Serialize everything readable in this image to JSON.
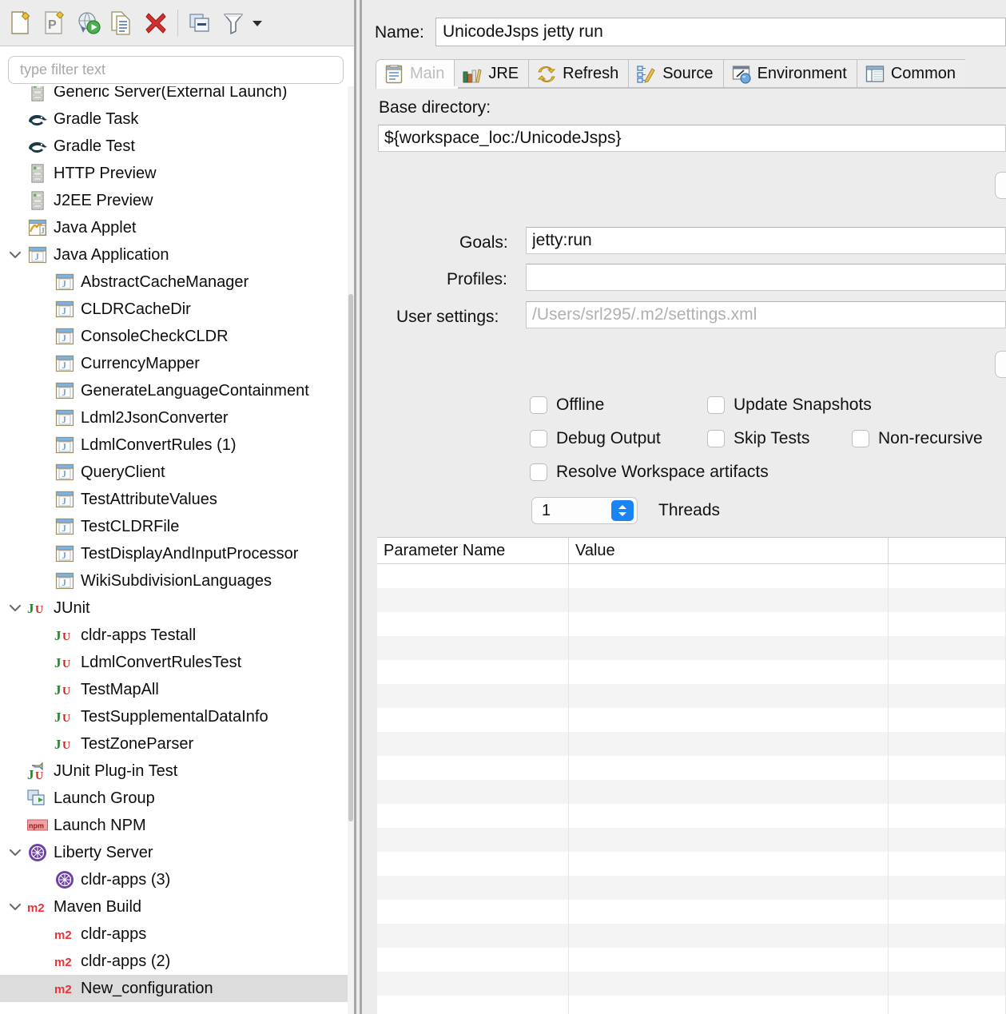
{
  "toolbar": {
    "buttons": [
      {
        "name": "new-launch-configuration-button",
        "icon": "new-config-icon",
        "tooltip": "New launch configuration"
      },
      {
        "name": "new-prototype-button",
        "icon": "new-prototype-icon",
        "tooltip": "New prototype"
      },
      {
        "name": "export-launch-configuration-button",
        "icon": "export-run-icon",
        "tooltip": "Export"
      },
      {
        "name": "duplicate-button",
        "icon": "duplicate-icon",
        "tooltip": "Duplicate"
      },
      {
        "name": "delete-button",
        "icon": "delete-x-icon",
        "tooltip": "Delete"
      },
      {
        "name": "collapse-all-button",
        "icon": "collapse-all-icon",
        "tooltip": "Collapse All"
      },
      {
        "name": "filter-button",
        "icon": "filter-funnel-icon",
        "tooltip": "Filter"
      }
    ],
    "filter_menu_caret": "chevron-down-icon"
  },
  "filter": {
    "placeholder": "type filter text",
    "value": ""
  },
  "tree": {
    "items": [
      {
        "label": "Generic Server(External Launch)",
        "icon": "server-icon",
        "depth": 0,
        "twist": "none",
        "selected": false
      },
      {
        "label": "Gradle Task",
        "icon": "gradle-icon",
        "depth": 0,
        "twist": "none",
        "selected": false
      },
      {
        "label": "Gradle Test",
        "icon": "gradle-icon",
        "depth": 0,
        "twist": "none",
        "selected": false
      },
      {
        "label": "HTTP Preview",
        "icon": "server-icon",
        "depth": 0,
        "twist": "none",
        "selected": false
      },
      {
        "label": "J2EE Preview",
        "icon": "server-icon",
        "depth": 0,
        "twist": "none",
        "selected": false
      },
      {
        "label": "Java Applet",
        "icon": "java-applet-icon",
        "depth": 0,
        "twist": "none",
        "selected": false
      },
      {
        "label": "Java Application",
        "icon": "java-app-icon",
        "depth": 0,
        "twist": "expanded",
        "selected": false
      },
      {
        "label": "AbstractCacheManager",
        "icon": "java-app-icon",
        "depth": 1,
        "twist": "none",
        "selected": false
      },
      {
        "label": "CLDRCacheDir",
        "icon": "java-app-icon",
        "depth": 1,
        "twist": "none",
        "selected": false
      },
      {
        "label": "ConsoleCheckCLDR",
        "icon": "java-app-icon",
        "depth": 1,
        "twist": "none",
        "selected": false
      },
      {
        "label": "CurrencyMapper",
        "icon": "java-app-icon",
        "depth": 1,
        "twist": "none",
        "selected": false
      },
      {
        "label": "GenerateLanguageContainment",
        "icon": "java-app-icon",
        "depth": 1,
        "twist": "none",
        "selected": false
      },
      {
        "label": "Ldml2JsonConverter",
        "icon": "java-app-icon",
        "depth": 1,
        "twist": "none",
        "selected": false
      },
      {
        "label": "LdmlConvertRules (1)",
        "icon": "java-app-icon",
        "depth": 1,
        "twist": "none",
        "selected": false
      },
      {
        "label": "QueryClient",
        "icon": "java-app-icon",
        "depth": 1,
        "twist": "none",
        "selected": false
      },
      {
        "label": "TestAttributeValues",
        "icon": "java-app-icon",
        "depth": 1,
        "twist": "none",
        "selected": false
      },
      {
        "label": "TestCLDRFile",
        "icon": "java-app-icon",
        "depth": 1,
        "twist": "none",
        "selected": false
      },
      {
        "label": "TestDisplayAndInputProcessor",
        "icon": "java-app-icon",
        "depth": 1,
        "twist": "none",
        "selected": false
      },
      {
        "label": "WikiSubdivisionLanguages",
        "icon": "java-app-icon",
        "depth": 1,
        "twist": "none",
        "selected": false
      },
      {
        "label": "JUnit",
        "icon": "junit-icon",
        "depth": 0,
        "twist": "expanded",
        "selected": false
      },
      {
        "label": "cldr-apps Testall",
        "icon": "junit-icon",
        "depth": 1,
        "twist": "none",
        "selected": false
      },
      {
        "label": "LdmlConvertRulesTest",
        "icon": "junit-icon",
        "depth": 1,
        "twist": "none",
        "selected": false
      },
      {
        "label": "TestMapAll",
        "icon": "junit-icon",
        "depth": 1,
        "twist": "none",
        "selected": false
      },
      {
        "label": "TestSupplementalDataInfo",
        "icon": "junit-icon",
        "depth": 1,
        "twist": "none",
        "selected": false
      },
      {
        "label": "TestZoneParser",
        "icon": "junit-icon",
        "depth": 1,
        "twist": "none",
        "selected": false
      },
      {
        "label": "JUnit Plug-in Test",
        "icon": "junit-plugin-icon",
        "depth": 0,
        "twist": "none",
        "selected": false
      },
      {
        "label": "Launch Group",
        "icon": "launch-group-icon",
        "depth": 0,
        "twist": "none",
        "selected": false
      },
      {
        "label": "Launch NPM",
        "icon": "npm-icon",
        "depth": 0,
        "twist": "none",
        "selected": false
      },
      {
        "label": "Liberty Server",
        "icon": "liberty-icon",
        "depth": 0,
        "twist": "expanded",
        "selected": false
      },
      {
        "label": "cldr-apps (3)",
        "icon": "liberty-icon",
        "depth": 1,
        "twist": "none",
        "selected": false
      },
      {
        "label": "Maven Build",
        "icon": "maven-icon",
        "depth": 0,
        "twist": "expanded",
        "selected": false
      },
      {
        "label": "cldr-apps",
        "icon": "maven-icon",
        "depth": 1,
        "twist": "none",
        "selected": false
      },
      {
        "label": "cldr-apps (2)",
        "icon": "maven-icon",
        "depth": 1,
        "twist": "none",
        "selected": false
      },
      {
        "label": "New_configuration",
        "icon": "maven-icon",
        "depth": 1,
        "twist": "none",
        "selected": true
      }
    ]
  },
  "details": {
    "name_label": "Name:",
    "name_value": "UnicodeJsps jetty run",
    "tabs": [
      {
        "label": "Main",
        "icon": "main-tab-icon",
        "active": true
      },
      {
        "label": "JRE",
        "icon": "jre-tab-icon",
        "active": false
      },
      {
        "label": "Refresh",
        "icon": "refresh-tab-icon",
        "active": false
      },
      {
        "label": "Source",
        "icon": "source-tab-icon",
        "active": false
      },
      {
        "label": "Environment",
        "icon": "environment-tab-icon",
        "active": false
      },
      {
        "label": "Common",
        "icon": "common-tab-icon",
        "active": false
      }
    ],
    "main": {
      "base_directory_label": "Base directory:",
      "base_directory_value": "${workspace_loc:/UnicodeJsps}",
      "goals_label": "Goals:",
      "goals_value": "jetty:run",
      "profiles_label": "Profiles:",
      "profiles_value": "",
      "user_settings_label": "User settings:",
      "user_settings_value": "",
      "user_settings_placeholder": "/Users/srl295/.m2/settings.xml",
      "edge_button_top_label": "",
      "edge_button_bottom_label": "",
      "checkboxes": [
        {
          "label": "Offline",
          "checked": false
        },
        {
          "label": "Update Snapshots",
          "checked": false
        },
        {
          "label": "Debug Output",
          "checked": false
        },
        {
          "label": "Skip Tests",
          "checked": false
        },
        {
          "label": "Non-recursive",
          "checked": false
        },
        {
          "label": "Resolve Workspace artifacts",
          "checked": false
        }
      ],
      "threads_value": "1",
      "threads_label": "Threads",
      "threads_stepper_icon": "stepper-up-down-icon"
    },
    "parameters_table": {
      "columns": [
        "Parameter Name",
        "Value",
        ""
      ],
      "rows": []
    }
  },
  "colors": {
    "accent_blue": "#1a84f2",
    "selection_gray": "#dcdcdc",
    "panel_bg": "#ececec",
    "delete_red": "#cf3030",
    "maven_red": "#e8323c",
    "junit_green": "#2f7d32",
    "junit_red": "#c62828",
    "liberty_purple": "#6c3fa8"
  }
}
